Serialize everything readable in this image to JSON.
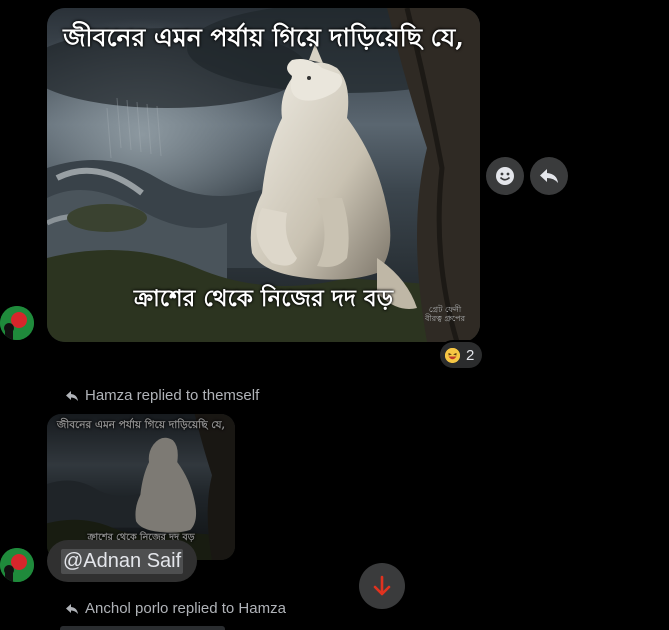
{
  "messages": {
    "main_image": {
      "caption_top": "জীবনের এমন পর্যায় গিয়ে দাড়িয়েছি যে,",
      "caption_bottom": "ক্রাশের থেকে নিজের দদ বড়",
      "watermark_line1": "গ্রেট ফেনী",
      "watermark_line2": "বীরত্ব গ্রুপের"
    },
    "reaction": {
      "emoji": "laughing-emoji",
      "count": "2"
    },
    "reply1": {
      "header": "Hamza replied to themself",
      "thumb_caption_top": "জীবনের এমন পর্যায় গিয়ে দাড়িয়েছি যে,",
      "thumb_caption_bottom": "ক্রাশের থেকে নিজের দদ বড়",
      "bubble_text": "@Adnan Saif"
    },
    "reply2": {
      "header": "Anchol porlo replied to Hamza"
    }
  },
  "icons": {
    "react": "smiley-icon",
    "reply": "reply-icon",
    "scroll": "arrow-down-icon",
    "reply_indicator": "reply-arrow-icon"
  },
  "colors": {
    "background": "#000000",
    "bubble": "#303030",
    "action_button": "#3a3b3c",
    "scroll_arrow": "#e0321f",
    "muted_text": "#b0b3b8"
  }
}
